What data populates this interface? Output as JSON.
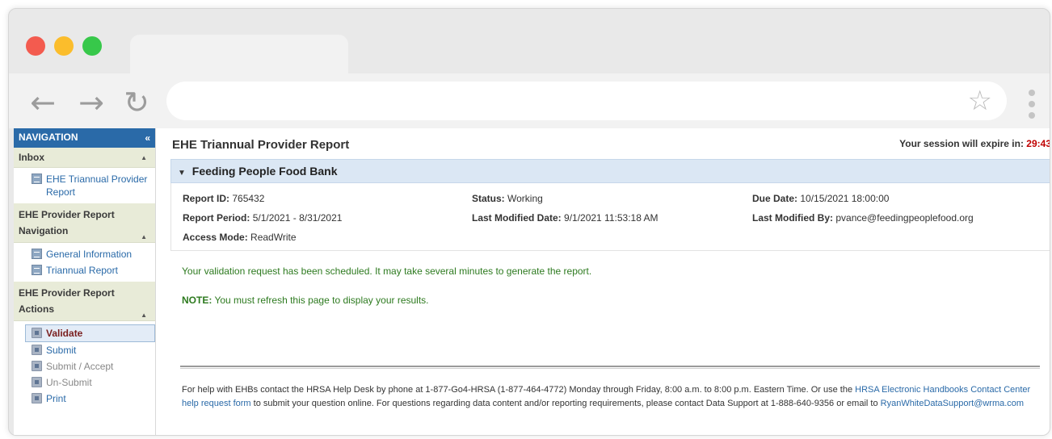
{
  "browser": {
    "address_value": "",
    "back_icon": "←",
    "forward_icon": "→",
    "reload_icon": "↻",
    "star_icon": "☆"
  },
  "sidebar": {
    "header": "NAVIGATION",
    "collapse_icon": "«",
    "sections": [
      {
        "title": "Inbox",
        "items": [
          {
            "label": "EHE Triannual Provider Report"
          }
        ]
      },
      {
        "title": "EHE Provider Report Navigation",
        "items": [
          {
            "label": "General Information"
          },
          {
            "label": "Triannual Report"
          }
        ]
      },
      {
        "title": "EHE Provider Report Actions",
        "items": [
          {
            "label": "Validate"
          },
          {
            "label": "Submit"
          },
          {
            "label": "Submit / Accept"
          },
          {
            "label": "Un-Submit"
          },
          {
            "label": "Print"
          }
        ]
      }
    ]
  },
  "main": {
    "title": "EHE Triannual Provider Report",
    "session_label": "Your session will expire in:",
    "session_time": "29:43",
    "org_name": "Feeding People Food Bank",
    "details": {
      "report_id_label": "Report ID:",
      "report_id": "765432",
      "status_label": "Status:",
      "status": "Working",
      "due_date_label": "Due Date:",
      "due_date": "10/15/2021 18:00:00",
      "report_period_label": "Report Period:",
      "report_period": "5/1/2021 - 8/31/2021",
      "last_modified_date_label": "Last Modified Date:",
      "last_modified_date": "9/1/2021 11:53:18 AM",
      "last_modified_by_label": "Last Modified By:",
      "last_modified_by": "pvance@feedingpeoplefood.org",
      "access_mode_label": "Access Mode:",
      "access_mode": "ReadWrite"
    },
    "message": "Your validation request has been scheduled. It may take several minutes to generate the report.",
    "note_label": "NOTE:",
    "note_text": "You must refresh this page to display your results.",
    "footer": {
      "text1": "For help with EHBs contact the HRSA Help Desk by phone at 1-877-Go4-HRSA (1-877-464-4772) Monday through Friday, 8:00 a.m. to 8:00 p.m. Eastern Time. Or use the ",
      "link1": "HRSA Electronic Handbooks Contact Center help request form",
      "text2": " to submit your question online. For questions regarding data content and/or reporting requirements, please contact Data Support at 1-888-640-9356 or email to ",
      "link2": "RyanWhiteDataSupport@wrma.com"
    }
  }
}
